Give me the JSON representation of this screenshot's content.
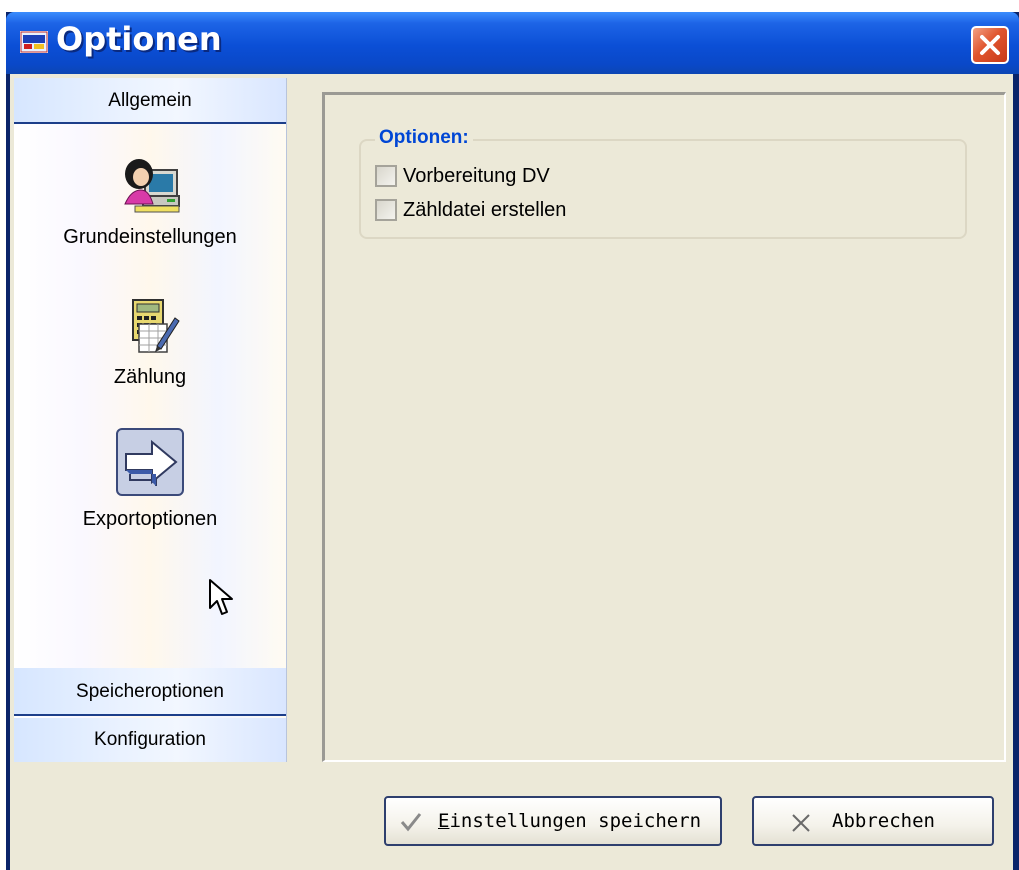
{
  "window": {
    "title": "Optionen"
  },
  "sidebar": {
    "tabs": {
      "allgemein": "Allgemein",
      "speicheroptionen": "Speicheroptionen",
      "konfiguration": "Konfiguration"
    },
    "items": [
      {
        "label": "Grundeinstellungen",
        "icon": "user-computer-icon"
      },
      {
        "label": "Zählung",
        "icon": "calculator-icon"
      },
      {
        "label": "Exportoptionen",
        "icon": "arrow-right-icon",
        "selected": true
      }
    ]
  },
  "main": {
    "group_title": "Optionen:",
    "options": [
      {
        "label": "Vorbereitung DV",
        "checked": false
      },
      {
        "label": "Zähldatei erstellen",
        "checked": false
      }
    ]
  },
  "buttons": {
    "save_first_letter": "E",
    "save_rest": "instellungen speichern",
    "cancel": "Abbrechen"
  },
  "colors": {
    "titlebar": "#0b4fd6",
    "group_title": "#0046d5",
    "close": "#e0552e",
    "client": "#ece9d8"
  }
}
